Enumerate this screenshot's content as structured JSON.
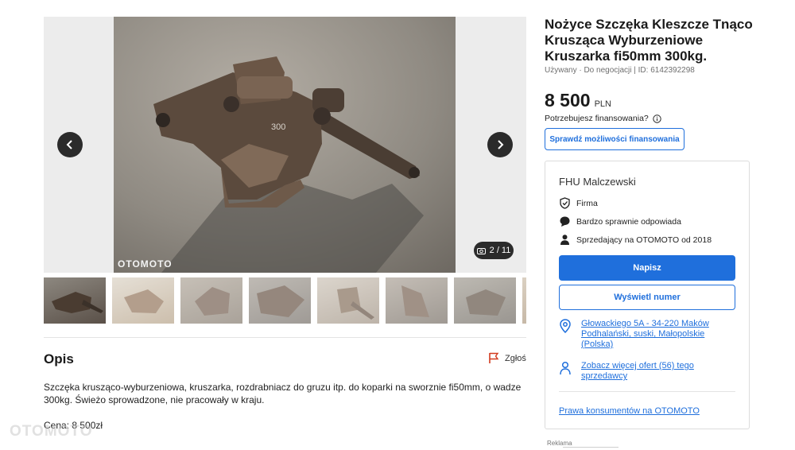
{
  "listing": {
    "title": "Nożyce Szczęka Kleszcze Tnąco Krusząca Wyburzeniowe Kruszarka fi50mm 300kg.",
    "meta": "Używany · Do negocjacji | ID: 6142392298",
    "price_value": "8 500",
    "price_currency": "PLN",
    "financing_question": "Potrzebujesz finansowania?",
    "financing_button": "Sprawdź możliwości finansowania"
  },
  "gallery": {
    "counter": "2 / 11",
    "watermark": "OTOMOTO",
    "prev_icon": "chevron-left-icon",
    "next_icon": "chevron-right-icon",
    "thumb_count": 8
  },
  "seller": {
    "name": "FHU Malczewski",
    "features": [
      {
        "icon": "shield-check-icon",
        "label": "Firma"
      },
      {
        "icon": "chat-bubble-icon",
        "label": "Bardzo sprawnie odpowiada"
      },
      {
        "icon": "person-icon",
        "label": "Sprzedający na OTOMOTO od 2018"
      }
    ],
    "write_button": "Napisz",
    "phone_button": "Wyświetl numer",
    "location": "Głowackiego 5A - 34-220 Maków Podhalański, suski, Małopolskie (Polska)",
    "other_offers": "Zobacz więcej ofert (56) tego sprzedawcy",
    "consumer_rights": "Prawa konsumentów na OTOMOTO"
  },
  "description": {
    "title": "Opis",
    "report": "Zgłoś",
    "text": "Szczęka kruszącо-wyburzeniowa, kruszarka, rozdrabniacz do gruzu itp. do koparki na sworznie fi50mm, o wadze 300kg. Świeżo sprowadzone, nie pracowały w kraju.",
    "price_line": "Cena: 8 500zł"
  },
  "ad": {
    "label": "Reklama"
  },
  "colors": {
    "accent": "#1f6fdc",
    "text": "#1a1a1a",
    "report": "#d23b1f"
  }
}
